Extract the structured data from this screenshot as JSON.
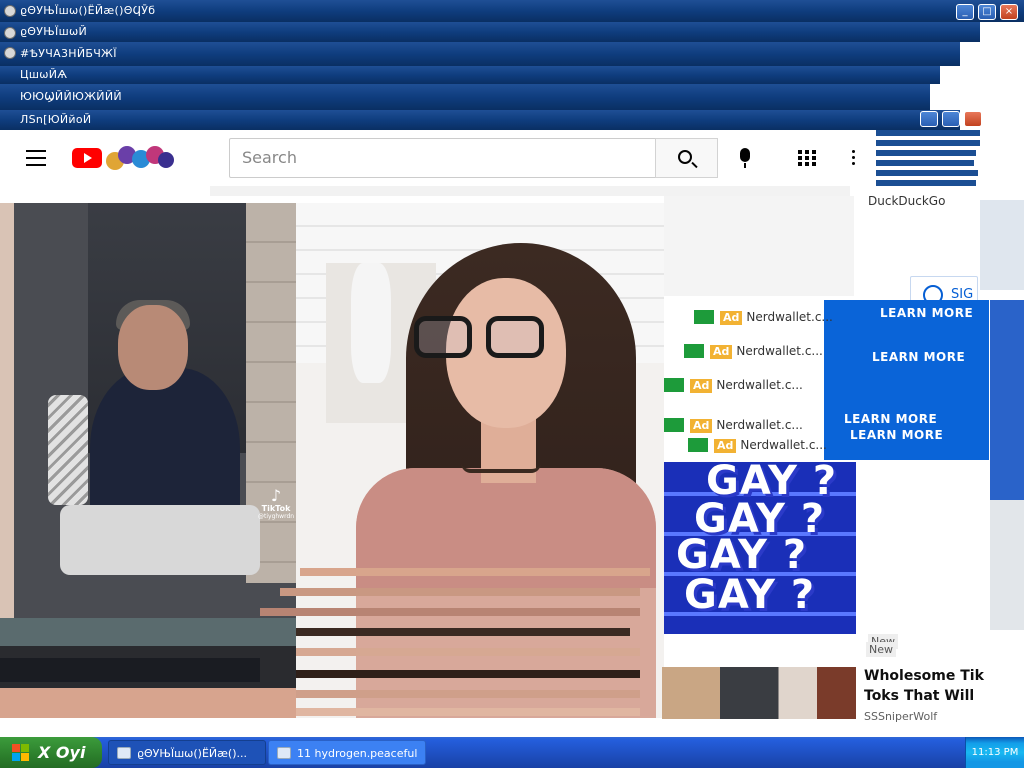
{
  "window": {
    "titles": [
      "ϱΘУЊЇшѡ()ЁЙæ()ΘϤӮб",
      "ϱΘУЊЇшѡЙ",
      "#ѢУЧА3НЙБЧЖЇ",
      "ЦшѡЙѦ",
      "ЮЮϢЙЙЮЖЙЙЙ",
      "ЛSn[ЮЙйоЙ"
    ],
    "controls": {
      "minimize": "_",
      "maximize": "□",
      "close": "×"
    }
  },
  "youtube": {
    "search": {
      "placeholder": "Search"
    },
    "sidebar": {
      "duckduckgo": "DuckDuckGo",
      "signin_label": "SIG"
    }
  },
  "video": {
    "tiktok_label": "TikTok",
    "tiktok_user": "@tiyghwrdn"
  },
  "ads": {
    "badge": "Ad",
    "advertiser": "Nerdwallet.c...",
    "cta": "LEARN MORE",
    "overlay_text": "GAY ?"
  },
  "recommended": {
    "badge": "New",
    "title": "Wholesome Tik Toks That Will",
    "channel": "SSSniperWolf"
  },
  "taskbar": {
    "start_label": "X Oyi",
    "tasks": [
      {
        "label": "ϱΘУЊЇшѡ()ЁЙæ()..."
      },
      {
        "label": "11 hydrogen.peaceful"
      }
    ],
    "clock": "11:13 PM"
  },
  "colors": {
    "xp_title": "#0f3d7e",
    "youtube_red": "#ff0000",
    "ad_yellow": "#f2b233",
    "learn_blue": "#0a64d8",
    "taskbar_blue": "#245edc",
    "start_green": "#2c7f2c"
  }
}
